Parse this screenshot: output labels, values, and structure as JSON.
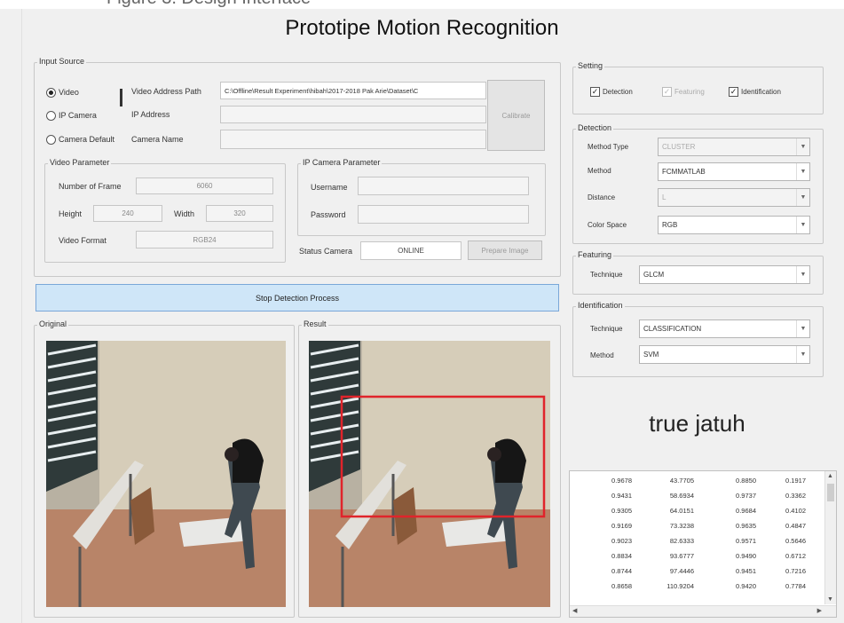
{
  "window": {
    "title": "Prototipe Motion Recognition"
  },
  "input_source": {
    "group_label": "Input Source",
    "radios": [
      {
        "label": "Video",
        "selected": true
      },
      {
        "label": "IP Camera",
        "selected": false
      },
      {
        "label": "Camera Default",
        "selected": false
      }
    ],
    "video_address_label": "Video Address Path",
    "video_address_value": "C:\\Offline\\Result Experiment\\hibah\\2017-2018 Pak Arie\\Dataset\\C",
    "ip_address_label": "IP Address",
    "camera_name_label": "Camera Name",
    "calibrate_label": "Calibrate"
  },
  "video_parameter": {
    "group_label": "Video Parameter",
    "frames_label": "Number of Frame",
    "frames_value": "6060",
    "height_label": "Height",
    "height_value": "240",
    "width_label": "Width",
    "width_value": "320",
    "format_label": "Video Format",
    "format_value": "RGB24"
  },
  "ip_camera_parameter": {
    "group_label": "IP Camera Parameter",
    "username_label": "Username",
    "password_label": "Password"
  },
  "status": {
    "label": "Status Camera",
    "value": "ONLINE",
    "prepare_label": "Prepare Image"
  },
  "stop_button": "Stop Detection Process",
  "original_label": "Original",
  "result_label": "Result",
  "setting": {
    "group_label": "Setting",
    "detection_check": "Detection",
    "featuring_check": "Featuring",
    "identification_check": "Identification"
  },
  "detection": {
    "group_label": "Detection",
    "method_type_label": "Method Type",
    "method_type_value": "CLUSTER",
    "method_label": "Method",
    "method_value": "FCMMATLAB",
    "distance_label": "Distance",
    "distance_value": "L",
    "color_space_label": "Color Space",
    "color_space_value": "RGB"
  },
  "featuring": {
    "group_label": "Featuring",
    "technique_label": "Technique",
    "technique_value": "GLCM"
  },
  "identification": {
    "group_label": "Identification",
    "technique_label": "Technique",
    "technique_value": "CLASSIFICATION",
    "method_label": "Method",
    "method_value": "SVM"
  },
  "result_text": "true jatuh",
  "table_rows": [
    [
      "0.9678",
      "43.7705",
      "0.8850",
      "0.1917"
    ],
    [
      "0.9431",
      "58.6934",
      "0.9737",
      "0.3362"
    ],
    [
      "0.9305",
      "64.0151",
      "0.9684",
      "0.4102"
    ],
    [
      "0.9169",
      "73.3238",
      "0.9635",
      "0.4847"
    ],
    [
      "0.9023",
      "82.6333",
      "0.9571",
      "0.5646"
    ],
    [
      "0.8834",
      "93.6777",
      "0.9490",
      "0.6712"
    ],
    [
      "0.8744",
      "97.4446",
      "0.9451",
      "0.7216"
    ],
    [
      "0.8658",
      "110.9204",
      "0.9420",
      "0.7784"
    ]
  ],
  "colors": {
    "accent": "#cfe6f8",
    "bbox": "#e0242b"
  }
}
